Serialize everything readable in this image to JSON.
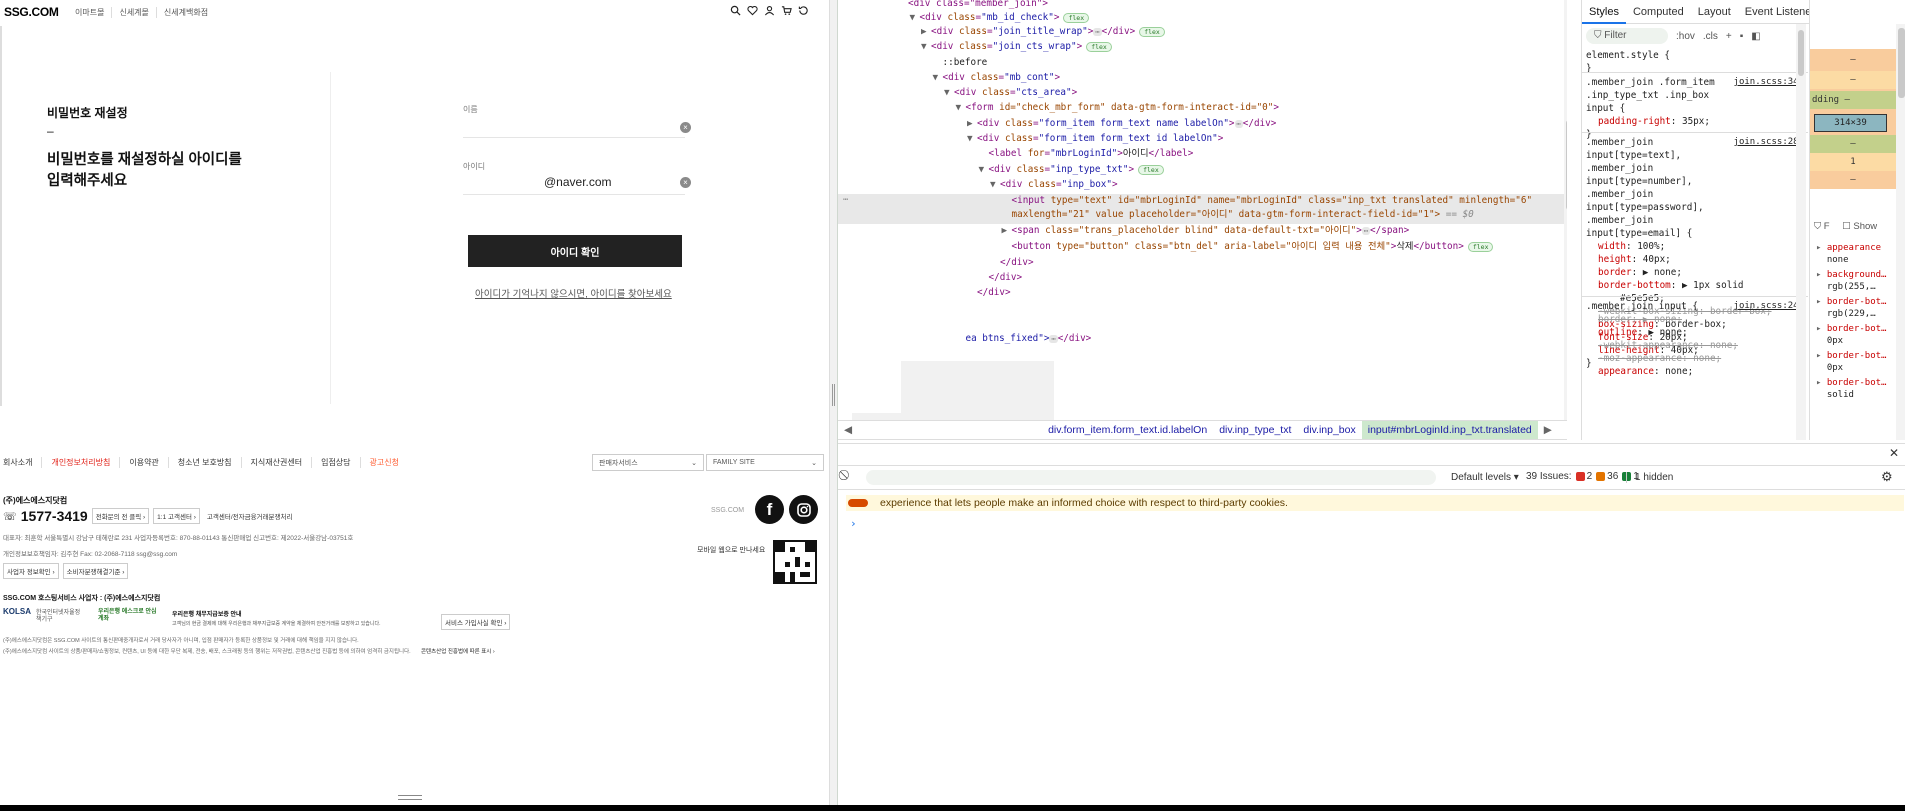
{
  "site": {
    "logo": "SSG.COM",
    "header_links": [
      "이마트몰",
      "신세계몰",
      "신세계백화점"
    ],
    "title": "비밀번호 재설정",
    "dash": "–",
    "description": "비밀번호를 재설정하실 아이디를 입력해주세요",
    "name_label": "이름",
    "id_label": "아이디",
    "id_value": "@naver.com",
    "delete_glyph": "×",
    "confirm_button": "아이디 확인",
    "find_link": "아이디가 기억나지 않으시면, 아이디를 찾아보세요",
    "footer_nav": [
      "회사소개",
      "개인정보처리방침",
      "이용약관",
      "청소년 보호방침",
      "지식재산권센터",
      "입점상담",
      "광고신청"
    ],
    "seller_service": "판매자서비스",
    "family_site": "FAMILY SITE",
    "company": "(주)에스에스지닷컴",
    "phone": "1577-3419",
    "chips": [
      "전화문의 전 클릭 ›",
      "1:1 고객센터 ›",
      "고객센터/전자금융거래분쟁처리"
    ],
    "address": "대표자: 최훈학   서울특별시 강남구 테헤란로 231   사업자등록번호: 870-88-01143   통신판매업 신고번호: 제2022-서울강남-03751호",
    "privacy": "개인정보보호책임자: 김주현   Fax: 02-2068-7118   ssg@ssg.com",
    "chips2": [
      "사업자 정보확인 ›",
      "소비자분쟁해결기준 ›"
    ],
    "ssgcom_mark": "SSG.COM",
    "facebook": "f",
    "mobile_note": "모바일 웹으로 만나세요",
    "hosting": "SSG.COM 호스팅서비스 사업자 : (주)에스에스지닷컴",
    "kolsa": "KOLSA",
    "kolsa_sub": "한국인터넷자율정책기구",
    "bank_logo": "우리은행 에스크로 안심계좌",
    "escrow_title": "우리은행 채무지급보증 안내",
    "escrow_desc": "고객님의 현금 결제에 대해 우리은행과 채무지급보증 계약을 체결하여 안전거래를 보장하고 있습니다.",
    "escrow_chip": "서비스 가입사실 확인 ›",
    "legal1": "(주)에스에스지닷컴은 SSG.COM 사이트의 통신판매중개자로서 거래 당사자가 아니며, 입점 판매자가 등록한 상품정보 및 거래에 대해 책임을 지지 않습니다.",
    "legal2": "(주)에스에스지닷컴 사이트의 상품/판매자/쇼핑정보, 컨텐츠, UI 등에 대한 무단 복제, 전송, 배포, 스크래핑 등의 행위는 저작권법, 콘텐츠산업 진흥법 등에 의하여 엄격히 금지됩니다.",
    "legal_link": "콘텐츠산업 진흥법에 따른 표시 ›",
    "colors": {
      "red": "#e2231a",
      "orange": "#ff5a2e"
    }
  },
  "devtools": {
    "dom": [
      {
        "indent": 0,
        "tri": "",
        "html": "&lt;div class=\"member_join\"&gt;"
      },
      {
        "indent": 1,
        "tri": "▼",
        "tag": "div",
        "cls": "mb_id_check",
        "badge": "flex"
      },
      {
        "indent": 2,
        "tri": "▶",
        "tag": "div",
        "cls": "join_title_wrap",
        "collapsed": true,
        "badge": "flex"
      },
      {
        "indent": 2,
        "tri": "▼",
        "tag": "div",
        "cls": "join_cts_wrap",
        "badge": "flex"
      },
      {
        "indent": 3,
        "tri": "",
        "pseudo": "::before"
      },
      {
        "indent": 3,
        "tri": "▼",
        "tag": "div",
        "cls": "mb_cont"
      },
      {
        "indent": 4,
        "tri": "▼",
        "tag": "div",
        "cls": "cts_area"
      },
      {
        "indent": 5,
        "tri": "▼",
        "raw": "form",
        "attrs": "id=\"check_mbr_form\" data-gtm-form-interact-id=\"0\""
      },
      {
        "indent": 6,
        "tri": "▶",
        "tag": "div",
        "cls": "form_item form_text name labelOn",
        "collapsed": true
      },
      {
        "indent": 6,
        "tri": "▼",
        "tag": "div",
        "cls": "form_item form_text id labelOn"
      },
      {
        "indent": 7,
        "tri": "",
        "label": "mbrLoginId",
        "labeltext": "아이디"
      },
      {
        "indent": 7,
        "tri": "▼",
        "tag": "div",
        "cls": "inp_type_txt",
        "badge": "flex"
      },
      {
        "indent": 8,
        "tri": "▼",
        "tag": "div",
        "cls": "inp_box"
      },
      {
        "indent": 9,
        "tri": "",
        "input1": "type=\"text\" id=\"mbrLoginId\" name=\"mbrLoginId\" class=\"inp_txt translated\" minlength=\"6\""
      },
      {
        "indent": 9,
        "tri": "",
        "input2": "maxlength=\"21\" value placeholder=\"아이디\" data-gtm-form-interact-field-id=\"1\"&gt;",
        "eq": "== $0"
      },
      {
        "indent": 9,
        "tri": "▶",
        "span": "class=\"trans_placeholder blind\" data-default-txt=\"아이디\""
      },
      {
        "indent": 9,
        "tri": "",
        "button": "type=\"button\" class=\"btn_del\" aria-label=\"아이디 입력 내용 전체\"",
        "btntext": "삭제",
        "badge": "flex"
      },
      {
        "indent": 8,
        "tri": "",
        "close": "div"
      },
      {
        "indent": 7,
        "tri": "",
        "close": "div"
      },
      {
        "indent": 6,
        "tri": "",
        "close": "div"
      },
      {
        "indent": 5,
        "tri": "",
        "tail": "ea btns_fixed\"&gt;"
      }
    ],
    "breadcrumb": [
      "div.form_item.form_text.id.labelOn",
      "div.inp_type_txt",
      "div.inp_box",
      "input#mbrLoginId.inp_txt.translated"
    ],
    "tabs": [
      "Styles",
      "Computed",
      "Layout",
      "Event Listeners",
      "»"
    ],
    "filter_placeholder": "Filter",
    "hov": ":hov",
    "cls": ".cls",
    "rules": {
      "element_style": "element.style {",
      "r1_sel": ".member_join .form_item .inp_type_txt .inp_box input {",
      "r1_src": "join.scss:346",
      "r1_prop": "padding-right",
      "r1_val": "35px;",
      "r2_sel": ".member_join input[type=text], .member_join input[type=number], .member_join input[type=password], .member_join input[type=email] {",
      "r2_src": "join.scss:280",
      "r2_lines": [
        "width: 100%;",
        "height: 40px;",
        "border: ▶ none;",
        "border-bottom: ▶ 1px solid",
        "#e5e5e5;",
        "-webkit-box-sizing: border-box;",
        "box-sizing: border-box;",
        "font-size: 20px;",
        "line-height: 40px;"
      ],
      "r3_sel": ".member_join input {",
      "r3_src": "join.scss:247",
      "r3_lines": [
        "border: ▶ none;",
        "outline: ▶ none;",
        "-webkit-appearance: none;",
        "-moz-appearance: none;",
        "appearance: none;"
      ]
    },
    "computed": {
      "bands": [
        "–",
        "–",
        "dding –",
        "–",
        "1",
        "–"
      ],
      "content": "314×39",
      "filter": "F",
      "show": "Show",
      "props": [
        {
          "n": "appearance",
          "v": "none"
        },
        {
          "n": "background…",
          "v": "rgb(255,…"
        },
        {
          "n": "border-bot…",
          "v": "rgb(229,…"
        },
        {
          "n": "border-bot…",
          "v": "0px"
        },
        {
          "n": "border-bot…",
          "v": "0px"
        },
        {
          "n": "border-bot…",
          "v": "solid"
        }
      ]
    },
    "console": {
      "close": "✕",
      "levels": "Default levels ▾",
      "issues_label": "39 Issues:",
      "issues": [
        {
          "count": "2",
          "color": "#d93025"
        },
        {
          "count": "36",
          "color": "#e37400"
        },
        {
          "count": "1",
          "color": "#188038"
        }
      ],
      "hidden": "1 hidden",
      "gear": "⚙",
      "cookie": "experience that lets people make an informed choice with respect to third-party cookies.",
      "prompt": "›"
    }
  }
}
